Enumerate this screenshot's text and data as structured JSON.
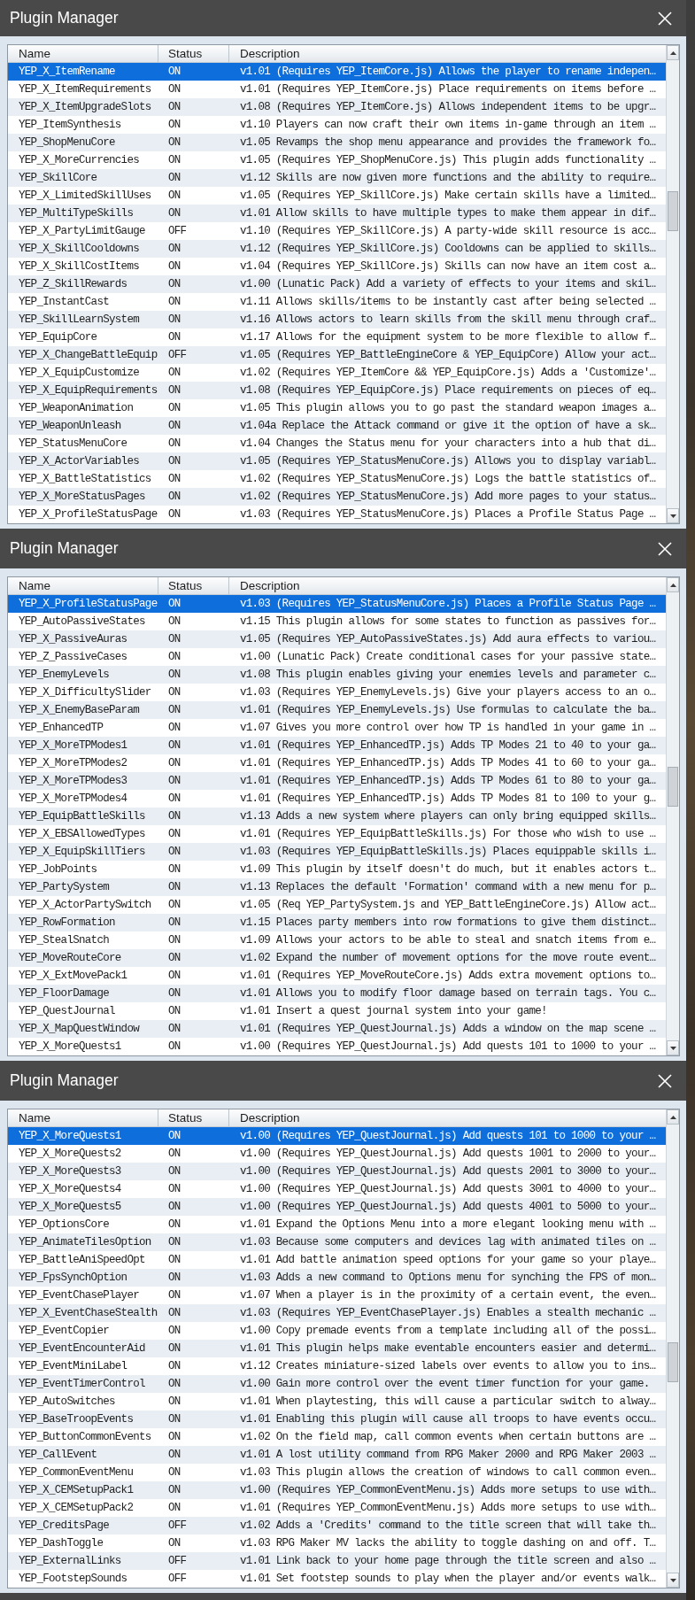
{
  "windows": [
    {
      "title": "Plugin Manager",
      "columns": [
        "Name",
        "Status",
        "Description"
      ],
      "rows": [
        {
          "name": "YEP_X_ItemRename",
          "status": "ON",
          "description": "v1.01 (Requires YEP_ItemCore.js) Allows the player to rename indepen…",
          "selected": true
        },
        {
          "name": "YEP_X_ItemRequirements",
          "status": "ON",
          "description": "v1.01 (Requires YEP_ItemCore.js) Place requirements on items before …",
          "selected": false
        },
        {
          "name": "YEP_X_ItemUpgradeSlots",
          "status": "ON",
          "description": "v1.08 (Requires YEP_ItemCore.js) Allows independent items to be upgr…",
          "selected": false
        },
        {
          "name": "YEP_ItemSynthesis",
          "status": "ON",
          "description": "v1.10 Players can now craft their own items in-game through an item …",
          "selected": false
        },
        {
          "name": "YEP_ShopMenuCore",
          "status": "ON",
          "description": "v1.05 Revamps the shop menu appearance and provides the framework fo…",
          "selected": false
        },
        {
          "name": "YEP_X_MoreCurrencies",
          "status": "ON",
          "description": "v1.05 (Requires YEP_ShopMenuCore.js) This plugin adds functionality …",
          "selected": false
        },
        {
          "name": "YEP_SkillCore",
          "status": "ON",
          "description": "v1.12 Skills are now given more functions and the ability to require…",
          "selected": false
        },
        {
          "name": "YEP_X_LimitedSkillUses",
          "status": "ON",
          "description": "v1.05 (Requires YEP_SkillCore.js) Make certain skills have a limited…",
          "selected": false
        },
        {
          "name": "YEP_MultiTypeSkills",
          "status": "ON",
          "description": "v1.01 Allow skills to have multiple types to make them appear in dif…",
          "selected": false
        },
        {
          "name": "YEP_X_PartyLimitGauge",
          "status": "OFF",
          "description": "v1.10 (Requires YEP_SkillCore.js) A party-wide skill resource is acc…",
          "selected": false
        },
        {
          "name": "YEP_X_SkillCooldowns",
          "status": "ON",
          "description": "v1.12 (Requires YEP_SkillCore.js) Cooldowns can be applied to skills…",
          "selected": false
        },
        {
          "name": "YEP_X_SkillCostItems",
          "status": "ON",
          "description": "v1.04 (Requires YEP_SkillCore.js) Skills can now have an item cost a…",
          "selected": false
        },
        {
          "name": "YEP_Z_SkillRewards",
          "status": "ON",
          "description": "v1.00 (Lunatic Pack) Add a variety of effects to your items and skil…",
          "selected": false
        },
        {
          "name": "YEP_InstantCast",
          "status": "ON",
          "description": "v1.11 Allows skills/items to be instantly cast after being selected …",
          "selected": false
        },
        {
          "name": "YEP_SkillLearnSystem",
          "status": "ON",
          "description": "v1.16 Allows actors to learn skills from the skill menu through craf…",
          "selected": false
        },
        {
          "name": "YEP_EquipCore",
          "status": "ON",
          "description": "v1.17 Allows for the equipment system to be more flexible to allow f…",
          "selected": false
        },
        {
          "name": "YEP_X_ChangeBattleEquip",
          "status": "OFF",
          "description": "v1.05 (Requires YEP_BattleEngineCore & YEP_EquipCore) Allow your act…",
          "selected": false
        },
        {
          "name": "YEP_X_EquipCustomize",
          "status": "ON",
          "description": "v1.02 (Requires YEP_ItemCore && YEP_EquipCore.js) Adds a 'Customize'…",
          "selected": false
        },
        {
          "name": "YEP_X_EquipRequirements",
          "status": "ON",
          "description": "v1.08 (Requires YEP_EquipCore.js) Place requirements on pieces of eq…",
          "selected": false
        },
        {
          "name": "YEP_WeaponAnimation",
          "status": "ON",
          "description": "v1.05 This plugin allows you to go past the standard weapon images a…",
          "selected": false
        },
        {
          "name": "YEP_WeaponUnleash",
          "status": "ON",
          "description": "v1.04a Replace the Attack command or give it the option of have a sk…",
          "selected": false
        },
        {
          "name": "YEP_StatusMenuCore",
          "status": "ON",
          "description": "v1.04 Changes the Status menu for your characters into a hub that di…",
          "selected": false
        },
        {
          "name": "YEP_X_ActorVariables",
          "status": "ON",
          "description": "v1.05 (Requires YEP_StatusMenuCore.js) Allows you to display variabl…",
          "selected": false
        },
        {
          "name": "YEP_X_BattleStatistics",
          "status": "ON",
          "description": "v1.02 (Requires YEP_StatusMenuCore.js) Logs the battle statistics of…",
          "selected": false
        },
        {
          "name": "YEP_X_MoreStatusPages",
          "status": "ON",
          "description": "v1.02 (Requires YEP_StatusMenuCore.js) Add more pages to your status…",
          "selected": false
        },
        {
          "name": "YEP_X_ProfileStatusPage",
          "status": "ON",
          "description": "v1.03 (Requires YEP_StatusMenuCore.js) Places a Profile Status Page …",
          "selected": false
        }
      ]
    },
    {
      "title": "Plugin Manager",
      "columns": [
        "Name",
        "Status",
        "Description"
      ],
      "rows": [
        {
          "name": "YEP_X_ProfileStatusPage",
          "status": "ON",
          "description": "v1.03 (Requires YEP_StatusMenuCore.js) Places a Profile Status Page …",
          "selected": true
        },
        {
          "name": "YEP_AutoPassiveStates",
          "status": "ON",
          "description": "v1.15 This plugin allows for some states to function as passives for…",
          "selected": false
        },
        {
          "name": "YEP_X_PassiveAuras",
          "status": "ON",
          "description": "v1.05 (Requires YEP_AutoPassiveStates.js) Add aura effects to variou…",
          "selected": false
        },
        {
          "name": "YEP_Z_PassiveCases",
          "status": "ON",
          "description": "v1.00 (Lunatic Pack) Create conditional cases for your passive state…",
          "selected": false
        },
        {
          "name": "YEP_EnemyLevels",
          "status": "ON",
          "description": "v1.08 This plugin enables giving your enemies levels and parameter c…",
          "selected": false
        },
        {
          "name": "YEP_X_DifficultySlider",
          "status": "ON",
          "description": "v1.03 (Requires YEP_EnemyLevels.js) Give your players access to an o…",
          "selected": false
        },
        {
          "name": "YEP_X_EnemyBaseParam",
          "status": "ON",
          "description": "v1.01 (Requires YEP_EnemyLevels.js) Use formulas to calculate the ba…",
          "selected": false
        },
        {
          "name": "YEP_EnhancedTP",
          "status": "ON",
          "description": "v1.07 Gives you more control over how TP is handled in your game in …",
          "selected": false
        },
        {
          "name": "YEP_X_MoreTPModes1",
          "status": "ON",
          "description": "v1.01 (Requires YEP_EnhancedTP.js) Adds TP Modes 21 to 40 to your ga…",
          "selected": false
        },
        {
          "name": "YEP_X_MoreTPModes2",
          "status": "ON",
          "description": "v1.01 (Requires YEP_EnhancedTP.js) Adds TP Modes 41 to 60 to your ga…",
          "selected": false
        },
        {
          "name": "YEP_X_MoreTPModes3",
          "status": "ON",
          "description": "v1.01 (Requires YEP_EnhancedTP.js) Adds TP Modes 61 to 80 to your ga…",
          "selected": false
        },
        {
          "name": "YEP_X_MoreTPModes4",
          "status": "ON",
          "description": "v1.01 (Requires YEP_EnhancedTP.js) Adds TP Modes 81 to 100 to your g…",
          "selected": false
        },
        {
          "name": "YEP_EquipBattleSkills",
          "status": "ON",
          "description": "v1.13 Adds a new system where players can only bring equipped skills…",
          "selected": false
        },
        {
          "name": "YEP_X_EBSAllowedTypes",
          "status": "ON",
          "description": "v1.01 (Requires YEP_EquipBattleSkills.js) For those who wish to use …",
          "selected": false
        },
        {
          "name": "YEP_X_EquipSkillTiers",
          "status": "ON",
          "description": "v1.03 (Requires YEP_EquipBattleSkills.js) Places equippable skills i…",
          "selected": false
        },
        {
          "name": "YEP_JobPoints",
          "status": "ON",
          "description": "v1.09 This plugin by itself doesn't do much, but it enables actors t…",
          "selected": false
        },
        {
          "name": "YEP_PartySystem",
          "status": "ON",
          "description": "v1.13 Replaces the default 'Formation' command with a new menu for p…",
          "selected": false
        },
        {
          "name": "YEP_X_ActorPartySwitch",
          "status": "ON",
          "description": "v1.05 (Req YEP_PartySystem.js and YEP_BattleEngineCore.js) Allow act…",
          "selected": false
        },
        {
          "name": "YEP_RowFormation",
          "status": "ON",
          "description": "v1.15 Places party members into row formations to give them distinct…",
          "selected": false
        },
        {
          "name": "YEP_StealSnatch",
          "status": "ON",
          "description": "v1.09 Allows your actors to be able to steal and snatch items from e…",
          "selected": false
        },
        {
          "name": "YEP_MoveRouteCore",
          "status": "ON",
          "description": "v1.02 Expand the number of movement options for the move route event…",
          "selected": false
        },
        {
          "name": "YEP_X_ExtMovePack1",
          "status": "ON",
          "description": "v1.01 (Requires YEP_MoveRouteCore.js) Adds extra movement options to…",
          "selected": false
        },
        {
          "name": "YEP_FloorDamage",
          "status": "ON",
          "description": "v1.01 Allows you to modify floor damage based on terrain tags. You c…",
          "selected": false
        },
        {
          "name": "YEP_QuestJournal",
          "status": "ON",
          "description": "v1.01 Insert a quest journal system into your game!",
          "selected": false
        },
        {
          "name": "YEP_X_MapQuestWindow",
          "status": "ON",
          "description": "v1.01 (Requires YEP_QuestJournal.js) Adds a window on the map scene …",
          "selected": false
        },
        {
          "name": "YEP_X_MoreQuests1",
          "status": "ON",
          "description": "v1.00 (Requires YEP_QuestJournal.js) Add quests 101 to 1000 to your …",
          "selected": false
        }
      ]
    },
    {
      "title": "Plugin Manager",
      "columns": [
        "Name",
        "Status",
        "Description"
      ],
      "rows": [
        {
          "name": "YEP_X_MoreQuests1",
          "status": "ON",
          "description": "v1.00 (Requires YEP_QuestJournal.js) Add quests 101 to 1000 to your …",
          "selected": true
        },
        {
          "name": "YEP_X_MoreQuests2",
          "status": "ON",
          "description": "v1.00 (Requires YEP_QuestJournal.js) Add quests 1001 to 2000 to your…",
          "selected": false
        },
        {
          "name": "YEP_X_MoreQuests3",
          "status": "ON",
          "description": "v1.00 (Requires YEP_QuestJournal.js) Add quests 2001 to 3000 to your…",
          "selected": false
        },
        {
          "name": "YEP_X_MoreQuests4",
          "status": "ON",
          "description": "v1.00 (Requires YEP_QuestJournal.js) Add quests 3001 to 4000 to your…",
          "selected": false
        },
        {
          "name": "YEP_X_MoreQuests5",
          "status": "ON",
          "description": "v1.00 (Requires YEP_QuestJournal.js) Add quests 4001 to 5000 to your…",
          "selected": false
        },
        {
          "name": "YEP_OptionsCore",
          "status": "ON",
          "description": "v1.01 Expand the Options Menu into a more elegant looking menu with …",
          "selected": false
        },
        {
          "name": "YEP_AnimateTilesOption",
          "status": "ON",
          "description": "v1.03 Because some computers and devices lag with animated tiles on …",
          "selected": false
        },
        {
          "name": "YEP_BattleAniSpeedOpt",
          "status": "ON",
          "description": "v1.01 Add battle animation speed options for your game so your playe…",
          "selected": false
        },
        {
          "name": "YEP_FpsSynchOption",
          "status": "ON",
          "description": "v1.03 Adds a new command to Options menu for synching the FPS of mon…",
          "selected": false
        },
        {
          "name": "YEP_EventChasePlayer",
          "status": "ON",
          "description": "v1.07 When a player is in the proximity of a certain event, the even…",
          "selected": false
        },
        {
          "name": "YEP_X_EventChaseStealth",
          "status": "ON",
          "description": "v1.03 (Requires YEP_EventChasePlayer.js) Enables a stealth mechanic …",
          "selected": false
        },
        {
          "name": "YEP_EventCopier",
          "status": "ON",
          "description": "v1.00 Copy premade events from a template including all of the possi…",
          "selected": false
        },
        {
          "name": "YEP_EventEncounterAid",
          "status": "ON",
          "description": "v1.01 This plugin helps make eventable encounters easier and determi…",
          "selected": false
        },
        {
          "name": "YEP_EventMiniLabel",
          "status": "ON",
          "description": "v1.12 Creates miniature-sized labels over events to allow you to ins…",
          "selected": false
        },
        {
          "name": "YEP_EventTimerControl",
          "status": "ON",
          "description": "v1.00 Gain more control over the event timer function for your game.",
          "selected": false
        },
        {
          "name": "YEP_AutoSwitches",
          "status": "ON",
          "description": "v1.01 When playtesting, this will cause a particular switch to alway…",
          "selected": false
        },
        {
          "name": "YEP_BaseTroopEvents",
          "status": "ON",
          "description": "v1.01 Enabling this plugin will cause all troops to have events occu…",
          "selected": false
        },
        {
          "name": "YEP_ButtonCommonEvents",
          "status": "ON",
          "description": "v1.02 On the field map, call common events when certain buttons are …",
          "selected": false
        },
        {
          "name": "YEP_CallEvent",
          "status": "ON",
          "description": "v1.01 A lost utility command from RPG Maker 2000 and RPG Maker 2003 …",
          "selected": false
        },
        {
          "name": "YEP_CommonEventMenu",
          "status": "ON",
          "description": "v1.03 This plugin allows the creation of windows to call common even…",
          "selected": false
        },
        {
          "name": "YEP_X_CEMSetupPack1",
          "status": "ON",
          "description": "v1.00 (Requires YEP_CommonEventMenu.js) Adds more setups to use with…",
          "selected": false
        },
        {
          "name": "YEP_X_CEMSetupPack2",
          "status": "ON",
          "description": "v1.01 (Requires YEP_CommonEventMenu.js) Adds more setups to use with…",
          "selected": false
        },
        {
          "name": "YEP_CreditsPage",
          "status": "OFF",
          "description": "v1.02 Adds a 'Credits' command to the title screen that will take th…",
          "selected": false
        },
        {
          "name": "YEP_DashToggle",
          "status": "ON",
          "description": "v1.03 RPG Maker MV lacks the ability to toggle dashing on and off. T…",
          "selected": false
        },
        {
          "name": "YEP_ExternalLinks",
          "status": "OFF",
          "description": "v1.01 Link back to your home page through the title screen and also …",
          "selected": false
        },
        {
          "name": "YEP_FootstepSounds",
          "status": "OFF",
          "description": "v1.01 Set footstep sounds to play when the player and/or events walk…",
          "selected": false
        }
      ]
    }
  ]
}
